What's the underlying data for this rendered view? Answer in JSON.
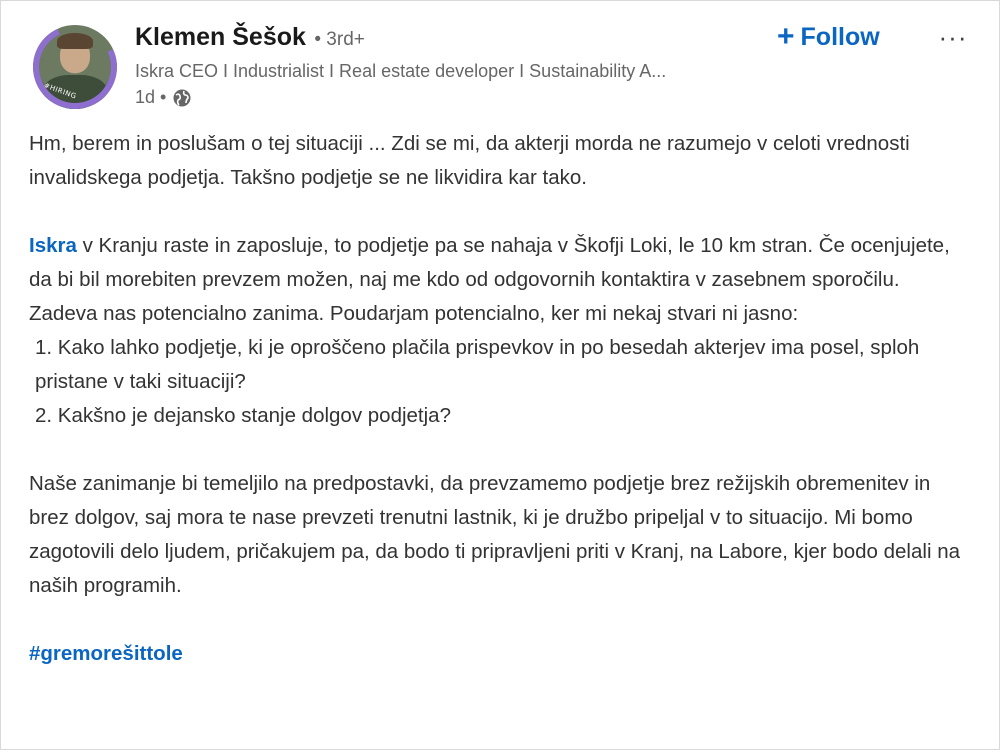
{
  "post": {
    "author": {
      "name": "Klemen Šešok",
      "degree": "• 3rd+",
      "headline": "Iskra CEO I Industrialist I Real estate developer I Sustainability A...",
      "time": "1d •",
      "avatar_badge": "#HIRING"
    },
    "actions": {
      "follow_label": "Follow",
      "follow_plus": "+",
      "more_label": "···"
    },
    "body": {
      "p1": "Hm, berem in poslušam o tej situaciji ... Zdi se mi, da akterji morda ne razumejo v celoti vrednosti invalidskega podjetja. Takšno podjetje se ne likvidira kar tako.",
      "p2_mention": "Iskra",
      "p2_rest": " v Kranju raste in zaposluje, to podjetje pa se nahaja v Škofji Loki, le 10 km stran. Če ocenjujete, da bi bil morebiten prevzem možen, naj me kdo od odgovornih kontaktira v zasebnem sporočilu. Zadeva nas potencialno zanima. Poudarjam potencialno, ker mi nekaj stvari ni jasno:",
      "list1": "1. Kako lahko podjetje, ki je oproščeno plačila prispevkov in po besedah akterjev ima posel, sploh pristane v taki situaciji?",
      "list2": "2. Kakšno je dejansko stanje dolgov podjetja?",
      "p3": "Naše zanimanje bi temeljilo na predpostavki, da prevzamemo podjetje brez režijskih obremenitev in brez dolgov, saj mora te nase prevzeti trenutni lastnik, ki je družbo pripeljal v to situacijo. Mi bomo zagotovili delo ljudem, pričakujem pa, da bodo ti pripravljeni priti v Kranj, na Labore, kjer bodo delali na naših programih.",
      "hashtag": "#gremorešittole"
    }
  },
  "colors": {
    "link": "#0a66c2",
    "text": "#333333",
    "muted": "#666666"
  },
  "icons": {
    "visibility": "globe-icon",
    "follow": "plus-icon",
    "menu": "more-icon"
  }
}
